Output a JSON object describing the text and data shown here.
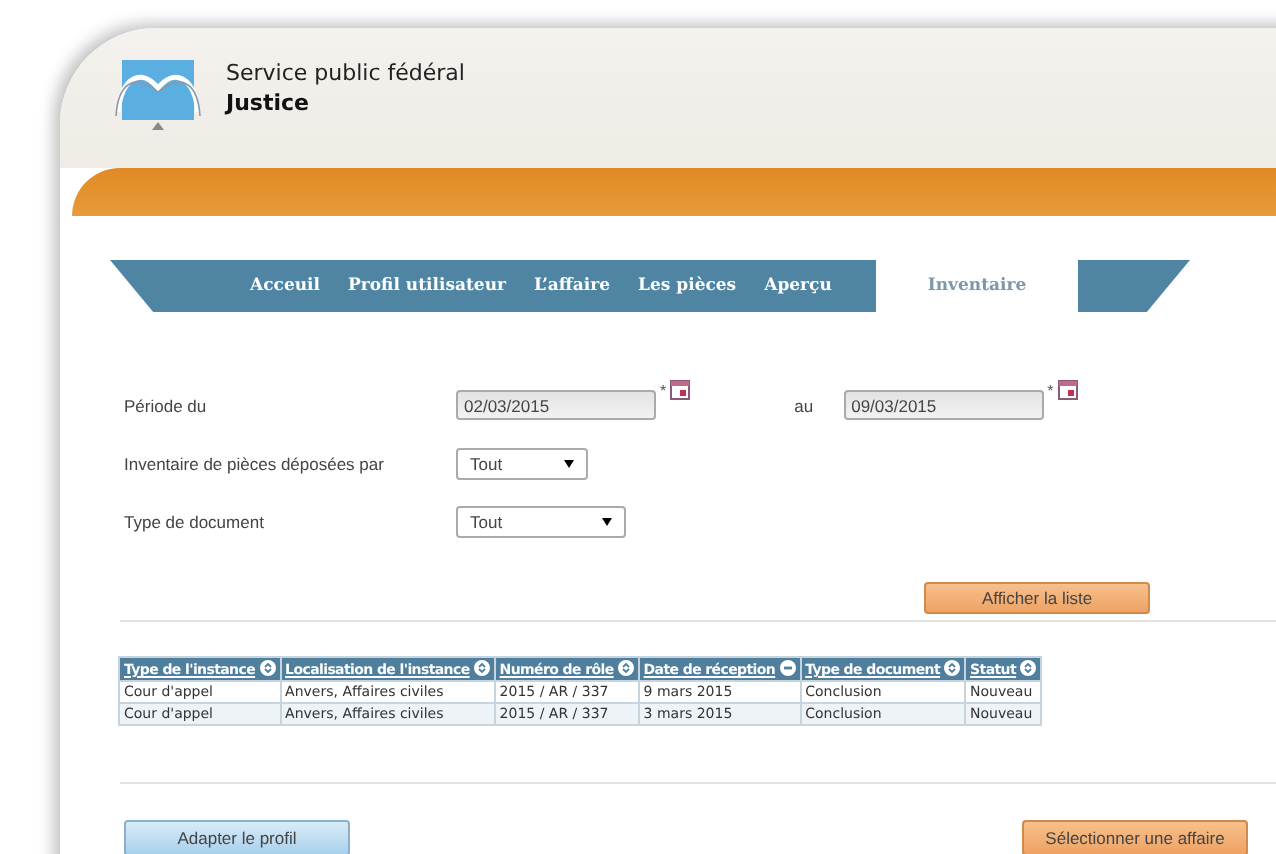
{
  "header": {
    "agency": "Service public fédéral",
    "department": "Justice"
  },
  "tabs": [
    {
      "label": "Acceuil",
      "selected": false
    },
    {
      "label": "Profil utilisateur",
      "selected": false
    },
    {
      "label": "L’affaire",
      "selected": false
    },
    {
      "label": "Les pièces",
      "selected": false
    },
    {
      "label": "Aperçu",
      "selected": false
    },
    {
      "label": "Inventaire",
      "selected": true
    }
  ],
  "form": {
    "period_label": "Période du",
    "date_from": "02/03/2015",
    "required_mark_from": "*",
    "to_label": "au",
    "date_to": "09/03/2015",
    "required_mark_to": "*",
    "deposited_by_label": "Inventaire de pièces déposées par",
    "deposited_by_value": "Tout",
    "doc_type_label": "Type de document",
    "doc_type_value": "Tout"
  },
  "show_button": "Afficher la liste",
  "table": {
    "columns": [
      {
        "label": "Type de l'instance",
        "sorted": false
      },
      {
        "label": "Localisation de l'instance",
        "sorted": false
      },
      {
        "label": "Numéro de rôle",
        "sorted": false
      },
      {
        "label": "Date de réception",
        "sorted": true
      },
      {
        "label": "Type de document",
        "sorted": false
      },
      {
        "label": "Statut",
        "sorted": false
      }
    ],
    "rows": [
      [
        "Cour d'appel",
        "Anvers, Affaires civiles",
        "2015 / AR / 337",
        "9 mars 2015",
        "Conclusion",
        "Nouveau"
      ],
      [
        "Cour d'appel",
        "Anvers, Affaires civiles",
        "2015 / AR / 337",
        "3 mars 2015",
        "Conclusion",
        "Nouveau"
      ]
    ]
  },
  "buttons": {
    "left": "Adapter le profil",
    "right": "Sélectionner une affaire"
  }
}
